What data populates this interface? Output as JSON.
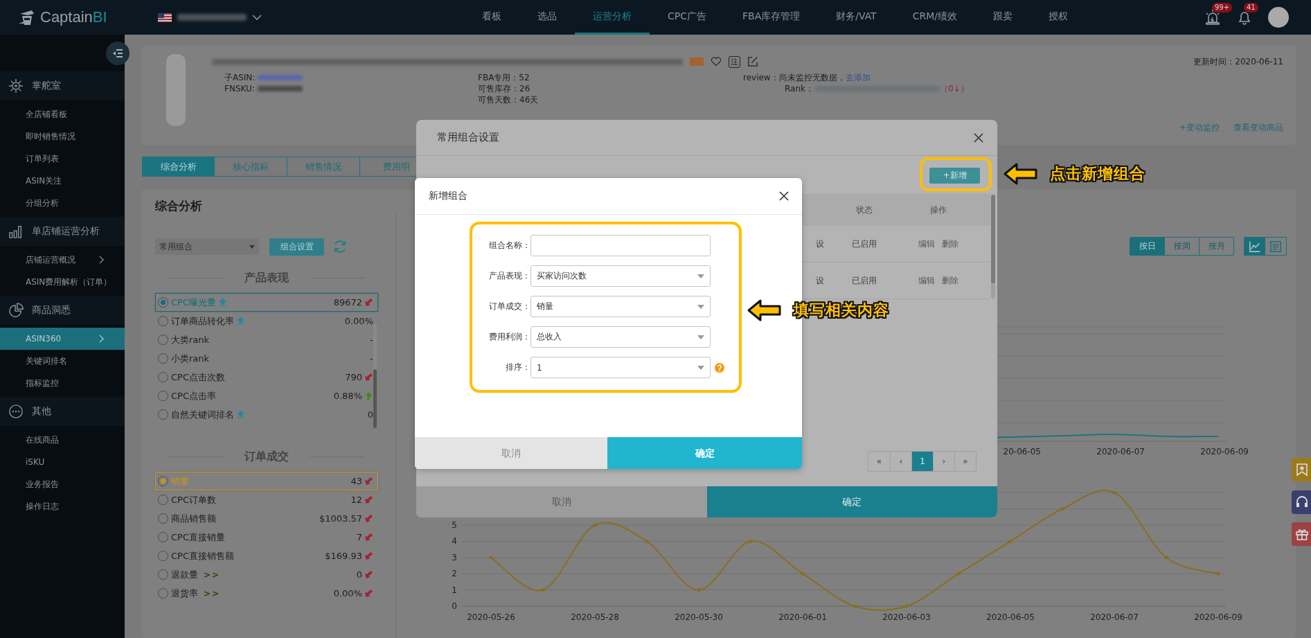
{
  "topbar": {
    "logo": {
      "text": "Captain",
      "accent": "BI"
    },
    "nav": [
      {
        "label": "看板",
        "selected": false
      },
      {
        "label": "选品",
        "selected": false
      },
      {
        "label": "运营分析",
        "selected": true
      },
      {
        "label": "CPC广告",
        "selected": false
      },
      {
        "label": "FBA库存管理",
        "selected": false
      },
      {
        "label": "财务/VAT",
        "selected": false
      },
      {
        "label": "CRM/绩效",
        "selected": false
      },
      {
        "label": "跟卖",
        "selected": false
      },
      {
        "label": "授权",
        "selected": false
      }
    ],
    "alarm_badge": "99+",
    "bell_badge": "41"
  },
  "sidebar": {
    "groups": [
      {
        "title": "掌舵室",
        "items": [
          {
            "label": "全店铺看板",
            "selected": false,
            "chevron": false
          },
          {
            "label": "即时销售情况",
            "selected": false,
            "chevron": false
          },
          {
            "label": "订单列表",
            "selected": false,
            "chevron": false
          },
          {
            "label": "ASIN关注",
            "selected": false,
            "chevron": false
          },
          {
            "label": "分组分析",
            "selected": false,
            "chevron": false
          }
        ]
      },
      {
        "title": "单店铺运营分析",
        "items": [
          {
            "label": "店铺运营概况",
            "selected": false,
            "chevron": true
          },
          {
            "label": "ASIN费用解析（订单）",
            "selected": false,
            "chevron": false
          }
        ]
      },
      {
        "title": "商品洞悉",
        "items": [
          {
            "label": "ASIN360",
            "selected": true,
            "chevron": true
          },
          {
            "label": "关键词排名",
            "selected": false,
            "chevron": false
          },
          {
            "label": "指标监控",
            "selected": false,
            "chevron": false
          }
        ]
      },
      {
        "title": "其他",
        "items": [
          {
            "label": "在线商品",
            "selected": false,
            "chevron": false
          },
          {
            "label": "iSKU",
            "selected": false,
            "chevron": false
          },
          {
            "label": "业务报告",
            "selected": false,
            "chevron": false
          },
          {
            "label": "操作日志",
            "selected": false,
            "chevron": false
          }
        ]
      }
    ]
  },
  "product": {
    "favorite": false,
    "note_label": "注",
    "asin_label": "子ASIN:",
    "fnsku_label": "FNSKU:",
    "stock": [
      "FBA专用：52",
      "可售库存：26",
      "可售天数：46天"
    ],
    "review": {
      "text": "review：尚未监控无数据，",
      "link": "去添加"
    },
    "rank": {
      "label": "Rank：",
      "change": "（0↓）"
    },
    "updated": "更新时间：2020-06-11",
    "links": [
      "+变动监控",
      "查看变动商品"
    ]
  },
  "tabs": [
    {
      "label": "综合分析",
      "selected": true
    },
    {
      "label": "核心指标",
      "selected": false
    },
    {
      "label": "销售情况",
      "selected": false
    },
    {
      "label": "费用明",
      "selected": false
    }
  ],
  "analysis": {
    "title": "综合分析",
    "combo_select": "常用组合",
    "combo_button": "组合设置",
    "sections": [
      {
        "title": "产品表现",
        "color": "#0f6d7a",
        "metrics": [
          {
            "name": "CPC曝光量",
            "value": "89672",
            "selected": true,
            "info": true,
            "falling": true,
            "rising": false
          },
          {
            "name": "订单商品转化率",
            "value": "0.00%",
            "selected": false,
            "info": true,
            "falling": false,
            "rising": false
          },
          {
            "name": "大类rank",
            "value": "-",
            "selected": false,
            "info": false,
            "falling": false,
            "rising": false
          },
          {
            "name": "小类rank",
            "value": "-",
            "selected": false,
            "info": false,
            "falling": false,
            "rising": false
          },
          {
            "name": "CPC点击次数",
            "value": "790",
            "selected": false,
            "info": false,
            "falling": true,
            "rising": false
          },
          {
            "name": "CPC点击率",
            "value": "0.88%",
            "selected": false,
            "info": false,
            "falling": false,
            "rising": true
          },
          {
            "name": "自然关键词排名",
            "value": "0",
            "selected": false,
            "info": true,
            "falling": false,
            "rising": false
          }
        ]
      },
      {
        "title": "订单成交",
        "color": "#c8961c",
        "metrics": [
          {
            "name": "销量",
            "value": "43",
            "selected": true,
            "info": false,
            "falling": true,
            "rising": false
          },
          {
            "name": "CPC订单数",
            "value": "12",
            "selected": false,
            "info": false,
            "falling": true,
            "rising": false
          },
          {
            "name": "商品销售额",
            "value": "$1003.57",
            "selected": false,
            "info": false,
            "falling": true,
            "rising": false
          },
          {
            "name": "CPC直接销量",
            "value": "7",
            "selected": false,
            "info": false,
            "falling": true,
            "rising": false
          },
          {
            "name": "CPC直接销售额",
            "value": "$169.93",
            "selected": false,
            "info": false,
            "falling": true,
            "rising": false
          },
          {
            "name": "退款量",
            "suffix": ">>",
            "value": "0",
            "selected": false,
            "info": false,
            "falling": true,
            "rising": false
          },
          {
            "name": "退货率",
            "suffix": ">>",
            "value": "0.00%",
            "selected": false,
            "info": false,
            "falling": true,
            "rising": false
          }
        ]
      }
    ],
    "granularity": [
      {
        "label": "按日",
        "selected": true
      },
      {
        "label": "按周",
        "selected": false
      },
      {
        "label": "按月",
        "selected": false
      }
    ],
    "view_modes": [
      {
        "selected": true
      },
      {
        "selected": false
      }
    ],
    "upper_chart": {
      "x_labels": [
        "20-06-05",
        "2020-06-07",
        "2020-06-09"
      ]
    },
    "chart_data": {
      "type": "line",
      "categories": [
        "2020-05-26",
        null,
        "2020-05-28",
        null,
        "2020-05-30",
        null,
        "2020-06-01",
        null,
        "2020-06-03",
        null,
        "2020-06-05",
        null,
        "2020-06-07",
        null,
        "2020-06-09"
      ],
      "series": [
        {
          "color": "#8a6d1e",
          "values": [
            3,
            1,
            5,
            4,
            1,
            4,
            2,
            0,
            0,
            2,
            4,
            6,
            7,
            3,
            2
          ]
        }
      ],
      "ylim": [
        0,
        7
      ],
      "yticks": [
        0,
        1,
        2,
        3,
        4,
        5
      ],
      "grid": true
    }
  },
  "combo_dialog": {
    "title": "常用组合设置",
    "add_button": "+新增",
    "columns": [
      "状态",
      "操作"
    ],
    "rows": [
      {
        "source": "设",
        "status": "已启用",
        "actions": [
          "编辑",
          "删除"
        ]
      },
      {
        "source": "设",
        "status": "已启用",
        "actions": [
          "编辑",
          "删除"
        ]
      }
    ],
    "pagination": {
      "first": "«",
      "prev": "‹",
      "pages": [
        {
          "label": "1",
          "selected": true
        }
      ],
      "next": "›",
      "last": "»"
    },
    "cancel": "取消",
    "confirm": "确定"
  },
  "add_dialog": {
    "title": "新增组合",
    "fields": [
      {
        "label": "组合名称：",
        "kind": "text",
        "help": false
      },
      {
        "label": "产品表现：",
        "kind": "select",
        "value": "买家访问次数",
        "help": false
      },
      {
        "label": "订单成交：",
        "kind": "select",
        "value": "销量",
        "help": false
      },
      {
        "label": "费用利润：",
        "kind": "select",
        "value": "总收入",
        "help": false
      },
      {
        "label": "排序：",
        "kind": "select",
        "value": "1",
        "help": true
      }
    ],
    "cancel": "取消",
    "confirm": "确定"
  },
  "annotations": [
    "点击新增组合",
    "填写相关内容"
  ]
}
